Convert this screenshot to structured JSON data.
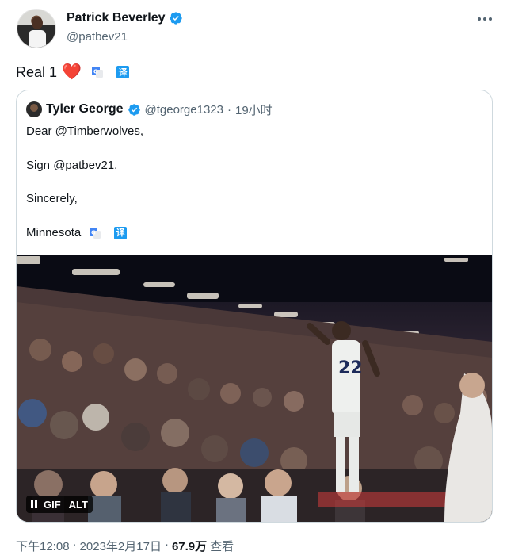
{
  "author": {
    "name": "Patrick Beverley",
    "handle": "@patbev21"
  },
  "tweet": {
    "text": "Real 1",
    "emoji": "❤️",
    "translate_label": "译"
  },
  "quoted": {
    "name": "Tyler George",
    "handle": "@tgeorge1323",
    "separator": "·",
    "time": "19小时",
    "lines": [
      "Dear @Timberwolves,",
      "Sign @patbev21.",
      "Sincerely,",
      "Minnesota"
    ],
    "translate_label": "译",
    "media": {
      "controls": {
        "gif": "GIF",
        "alt": "ALT"
      }
    }
  },
  "meta": {
    "time": "下午12:08",
    "separator": "·",
    "date": "2023年2月17日",
    "separator2": "·",
    "views": "67.9万",
    "views_label": "查看"
  },
  "colors": {
    "accent": "#1d9bf0",
    "heart": "#e0245e",
    "muted": "#536471"
  }
}
